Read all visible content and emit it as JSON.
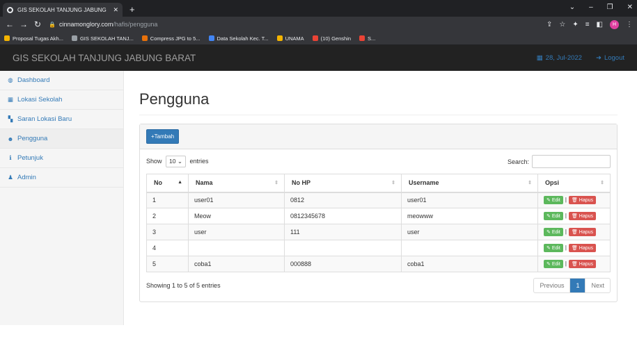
{
  "browser": {
    "tab_title": "GIS SEKOLAH TANJUNG JABUNG",
    "url_host": "cinnamonglory.com",
    "url_path": "/hafis/pengguna",
    "profile_initial": "H",
    "bookmarks": [
      {
        "label": "Proposal Tugas Akh...",
        "color": "#f4b400"
      },
      {
        "label": "GIS SEKOLAH TANJ...",
        "color": "#9aa0a6"
      },
      {
        "label": "Compress JPG to 5...",
        "color": "#e8710a"
      },
      {
        "label": "Data Sekolah Kec. T...",
        "color": "#4285f4"
      },
      {
        "label": "UNAMA",
        "color": "#f4b400"
      },
      {
        "label": "(10) Genshin",
        "color": "#ea4335"
      },
      {
        "label": "S...",
        "color": "#ea4335"
      }
    ]
  },
  "header": {
    "brand": "GIS SEKOLAH TANJUNG JABUNG BARAT",
    "date": "28, Jul-2022",
    "logout": "Logout"
  },
  "sidebar": {
    "items": [
      {
        "label": "Dashboard",
        "icon": "dashboard-icon",
        "glyph": "◍"
      },
      {
        "label": "Lokasi Sekolah",
        "icon": "table-icon",
        "glyph": "▦"
      },
      {
        "label": "Saran Lokasi Baru",
        "icon": "map-icon",
        "glyph": "▚"
      },
      {
        "label": "Pengguna",
        "icon": "users-icon",
        "glyph": "☻"
      },
      {
        "label": "Petunjuk",
        "icon": "info-icon",
        "glyph": "ℹ"
      },
      {
        "label": "Admin",
        "icon": "user-icon",
        "glyph": "♟"
      }
    ],
    "active_index": 3
  },
  "main": {
    "title": "Pengguna",
    "add_button": "Tambah",
    "show_label": "Show",
    "entries_value": "10",
    "entries_label": "entries",
    "search_label": "Search:",
    "search_value": "",
    "columns": [
      "No",
      "Nama",
      "No HP",
      "Username",
      "Opsi"
    ],
    "rows": [
      {
        "no": "1",
        "nama": "user01",
        "hp": "0812",
        "username": "user01"
      },
      {
        "no": "2",
        "nama": "Meow",
        "hp": "0812345678",
        "username": "meowww"
      },
      {
        "no": "3",
        "nama": "user",
        "hp": "111",
        "username": "user"
      },
      {
        "no": "4",
        "nama": "",
        "hp": "",
        "username": ""
      },
      {
        "no": "5",
        "nama": "coba1",
        "hp": "000888",
        "username": "coba1"
      }
    ],
    "edit_label": "Edit",
    "delete_label": "Hapus",
    "info": "Showing 1 to 5 of 5 entries",
    "pagination": {
      "previous": "Previous",
      "current": "1",
      "next": "Next"
    }
  }
}
